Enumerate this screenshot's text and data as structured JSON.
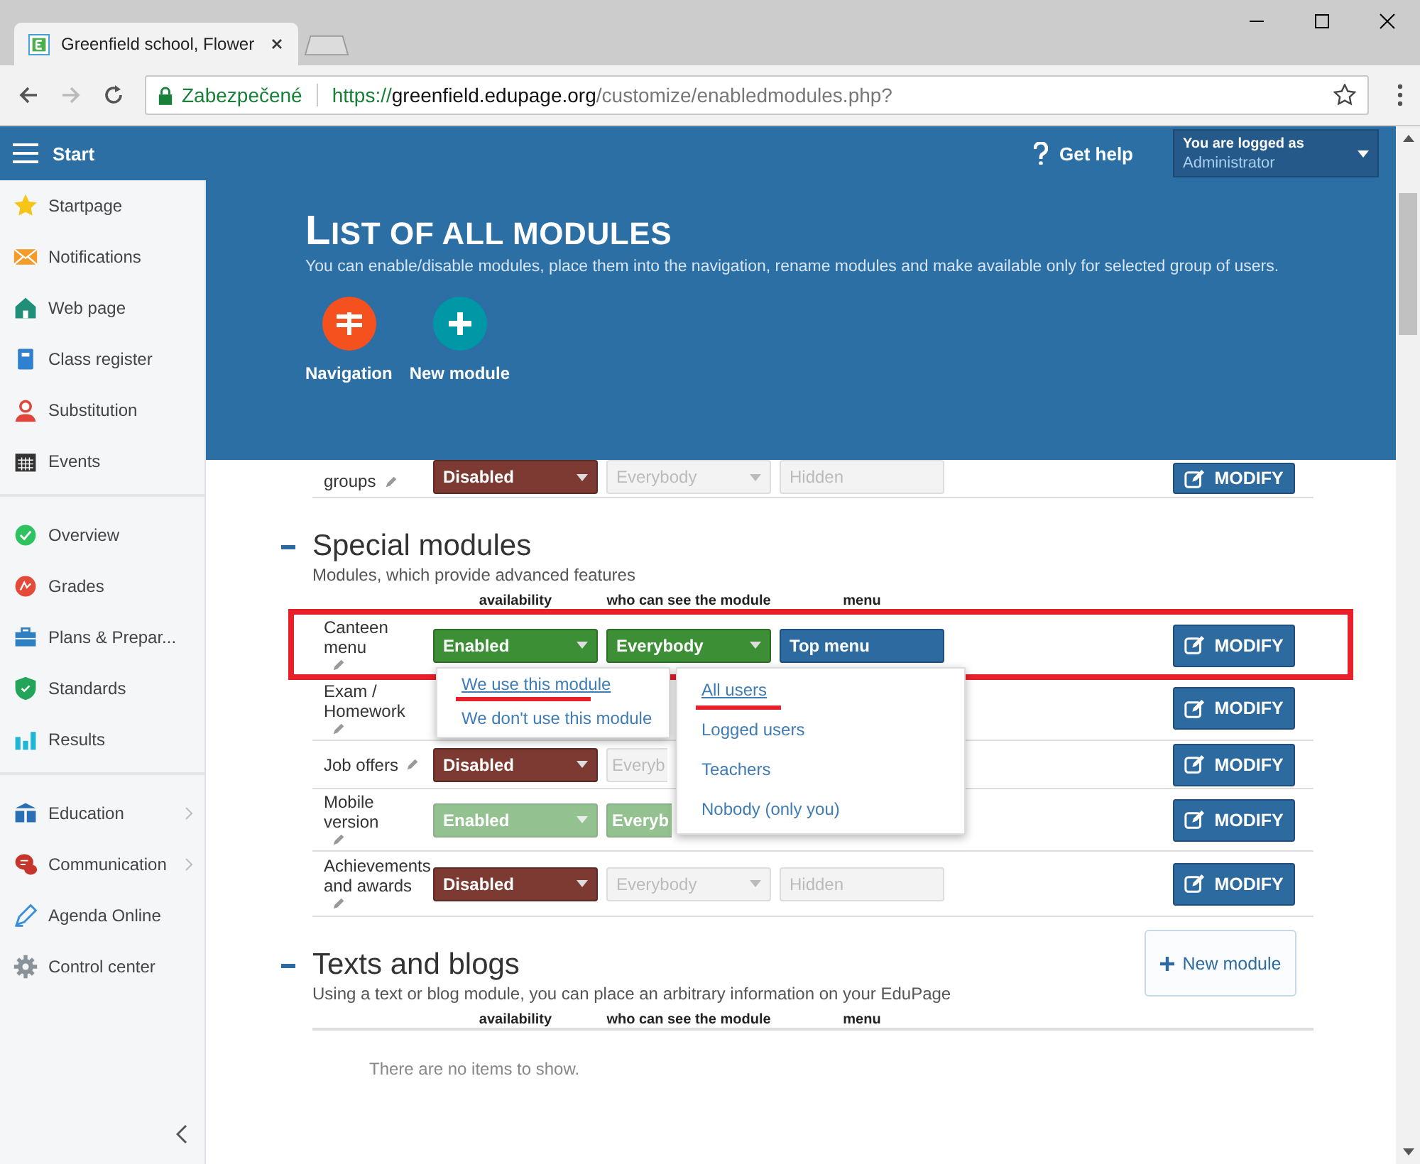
{
  "browser": {
    "tab_title": "Greenfield school, Flower",
    "security_label": "Zabezpečené",
    "url": {
      "scheme": "https://",
      "host": "greenfield.edupage.org",
      "path": "/customize/enabledmodules.php?"
    }
  },
  "header": {
    "start": "Start",
    "help": "Get help",
    "user": {
      "caption": "You are logged as",
      "role": "Administrator"
    }
  },
  "sidebar": {
    "groups": [
      [
        {
          "label": "Startpage",
          "kind": "star",
          "submenu": false
        },
        {
          "label": "Notifications",
          "kind": "envelope",
          "submenu": false
        },
        {
          "label": "Web page",
          "kind": "house",
          "submenu": false
        },
        {
          "label": "Class register",
          "kind": "notebook",
          "submenu": false
        },
        {
          "label": "Substitution",
          "kind": "person",
          "submenu": false
        },
        {
          "label": "Events",
          "kind": "calendar",
          "submenu": false
        }
      ],
      [
        {
          "label": "Overview",
          "kind": "check",
          "submenu": false
        },
        {
          "label": "Grades",
          "kind": "grades",
          "submenu": false
        },
        {
          "label": "Plans & Prepar...",
          "kind": "briefcase",
          "submenu": false
        },
        {
          "label": "Standards",
          "kind": "shield",
          "submenu": false
        },
        {
          "label": "Results",
          "kind": "chart",
          "submenu": false
        }
      ],
      [
        {
          "label": "Education",
          "kind": "book",
          "submenu": true
        },
        {
          "label": "Communication",
          "kind": "chat",
          "submenu": true
        },
        {
          "label": "Agenda Online",
          "kind": "pen",
          "submenu": false
        },
        {
          "label": "Control center",
          "kind": "gear",
          "submenu": false
        }
      ]
    ]
  },
  "banner": {
    "title": "LIST OF ALL MODULES",
    "subtitle": "You can enable/disable modules, place them into the navigation, rename modules and make available only for selected group of users.",
    "actions": [
      {
        "label": "Navigation",
        "kind": "navigation"
      },
      {
        "label": "New module",
        "kind": "new"
      }
    ]
  },
  "top_row": {
    "name": "groups",
    "availability": {
      "label": "Disabled",
      "kind": "disabled",
      "faded": false,
      "partial": false
    },
    "visibility": {
      "label": "Everybody",
      "kind": "inactive",
      "faded": false,
      "partial": false
    },
    "menu": {
      "label": "Hidden",
      "kind": "inactive",
      "faded": false,
      "partial": false
    },
    "button": "MODIFY"
  },
  "sections": [
    {
      "title": "Special modules",
      "subtitle": "Modules, which provide advanced features",
      "columns": [
        "availability",
        "who can see the module",
        "menu"
      ],
      "rows": [
        {
          "name": "Canteen menu",
          "highlighted": true,
          "availability": {
            "label": "Enabled",
            "kind": "enabled",
            "faded": false,
            "partial": false
          },
          "visibility": {
            "label": "Everybody",
            "kind": "enabled",
            "faded": false,
            "partial": false
          },
          "menu": {
            "label": "Top menu",
            "kind": "menu",
            "faded": false,
            "partial": false
          },
          "button": "MODIFY"
        },
        {
          "name": "Exam / Homework",
          "highlighted": false,
          "button": "MODIFY"
        },
        {
          "name": "Job offers",
          "highlighted": false,
          "availability": {
            "label": "Disabled",
            "kind": "disabled",
            "faded": false,
            "partial": false
          },
          "visibility": {
            "label": "Everyb",
            "kind": "inactive",
            "faded": false,
            "partial": true
          },
          "button": "MODIFY"
        },
        {
          "name": "Mobile version",
          "highlighted": false,
          "availability": {
            "label": "Enabled",
            "kind": "enabled",
            "faded": true,
            "partial": false
          },
          "visibility": {
            "label": "Everyb",
            "kind": "enabled",
            "faded": true,
            "partial": true
          },
          "button": "MODIFY"
        },
        {
          "name": "Achievements and awards",
          "highlighted": false,
          "availability": {
            "label": "Disabled",
            "kind": "disabled",
            "faded": false,
            "partial": false
          },
          "visibility": {
            "label": "Everybody",
            "kind": "inactive",
            "faded": false,
            "partial": false
          },
          "menu": {
            "label": "Hidden",
            "kind": "inactive",
            "faded": false,
            "partial": false
          },
          "button": "MODIFY"
        }
      ]
    },
    {
      "title": "Texts and blogs",
      "subtitle": "Using a text or blog module, you can place an arbitrary information on your EduPage",
      "new_button": "New module",
      "columns": [
        "availability",
        "who can see the module",
        "menu"
      ],
      "empty_text": "There are no items to show."
    }
  ],
  "dropdowns": [
    {
      "options": [
        {
          "label": "We use this module",
          "underlined": true
        },
        {
          "label": "We don't use this module",
          "underlined": false
        }
      ]
    },
    {
      "options": [
        {
          "label": "All users",
          "underlined": true
        },
        {
          "label": "Logged users",
          "underlined": false
        },
        {
          "label": "Teachers",
          "underlined": false
        },
        {
          "label": "Nobody (only you)",
          "underlined": false
        }
      ]
    }
  ]
}
